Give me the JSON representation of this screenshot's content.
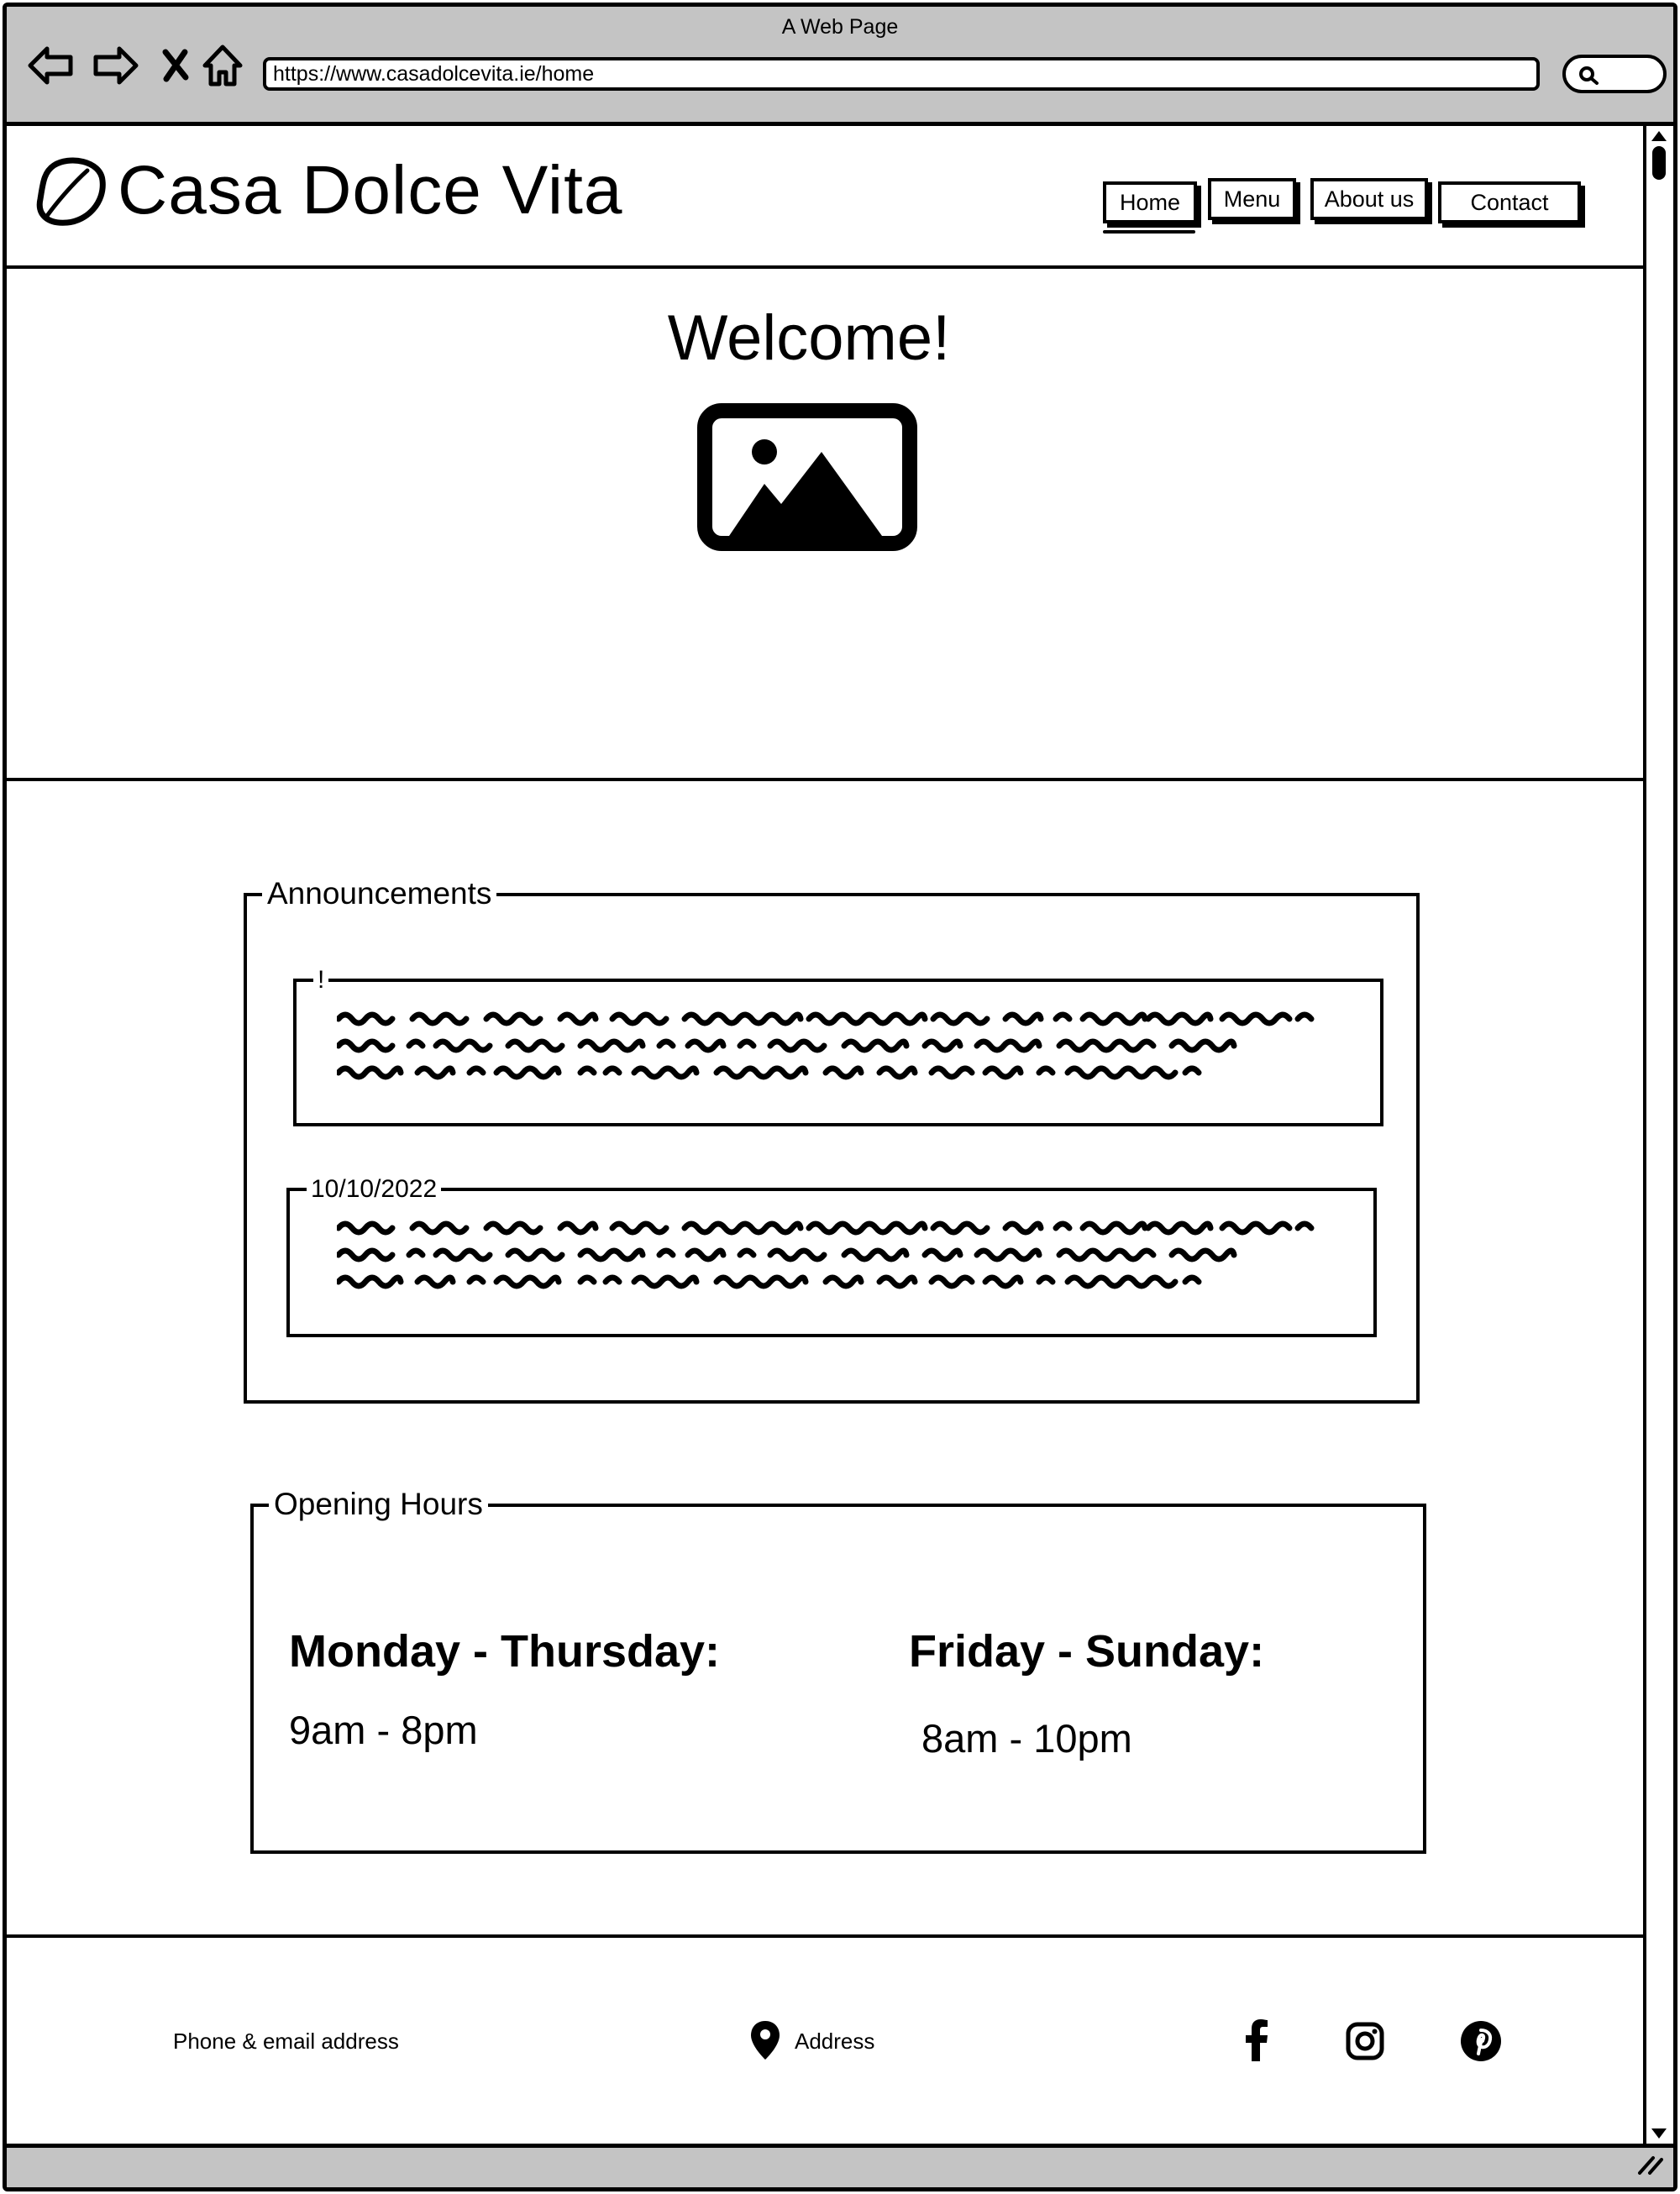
{
  "browser": {
    "window_title": "A Web Page",
    "url": "https://www.casadolcevita.ie/home",
    "nav_icons": [
      "back-arrow-icon",
      "forward-arrow-icon",
      "close-icon",
      "home-icon"
    ],
    "search_icon": "search-icon"
  },
  "header": {
    "logo_icon": "lemon-icon",
    "site_name": "Casa Dolce Vita",
    "nav": [
      {
        "label": "Home",
        "active": true
      },
      {
        "label": "Menu",
        "active": false
      },
      {
        "label": "About us",
        "active": false
      },
      {
        "label": "Contact",
        "active": false
      }
    ]
  },
  "hero": {
    "title": "Welcome!",
    "image_icon": "image-placeholder-icon"
  },
  "announcements": {
    "legend": "Announcements",
    "items": [
      {
        "label": "!"
      },
      {
        "label": "10/10/2022"
      }
    ]
  },
  "opening_hours": {
    "legend": "Opening Hours",
    "groups": [
      {
        "days": "Monday - Thursday:",
        "time": "9am - 8pm"
      },
      {
        "days": "Friday - Sunday:",
        "time": "8am - 10pm"
      }
    ]
  },
  "footer": {
    "contact": "Phone & email address",
    "address": "Address",
    "address_icon": "map-pin-icon",
    "social_icons": [
      "facebook-icon",
      "instagram-icon",
      "pinterest-icon"
    ]
  }
}
